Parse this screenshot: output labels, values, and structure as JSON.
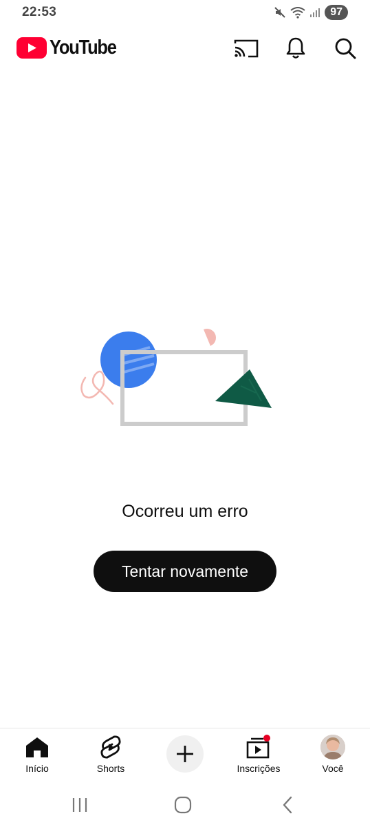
{
  "status_bar": {
    "time": "22:53",
    "battery": "97",
    "icons": [
      "mute-icon",
      "wifi-icon",
      "signal-icon"
    ]
  },
  "header": {
    "logo_text": "YouTube",
    "brand_color": "#ff0033",
    "actions": [
      "cast-icon",
      "bell-icon",
      "search-icon"
    ]
  },
  "error": {
    "message": "Ocorreu um erro",
    "retry_label": "Tentar novamente",
    "illustration_colors": {
      "circle": "#3b7ded",
      "frame": "#cccccc",
      "triangle": "#0f5a45",
      "accent": "#f3b8b2"
    }
  },
  "bottom_nav": {
    "items": [
      {
        "label": "Início",
        "icon": "home-icon",
        "active": true
      },
      {
        "label": "Shorts",
        "icon": "shorts-icon"
      },
      {
        "label": "",
        "icon": "plus-icon"
      },
      {
        "label": "Inscrições",
        "icon": "subscriptions-icon",
        "badge": true
      },
      {
        "label": "Você",
        "icon": "avatar"
      }
    ]
  },
  "system_nav": [
    "recents-icon",
    "home-circle-icon",
    "back-icon"
  ]
}
